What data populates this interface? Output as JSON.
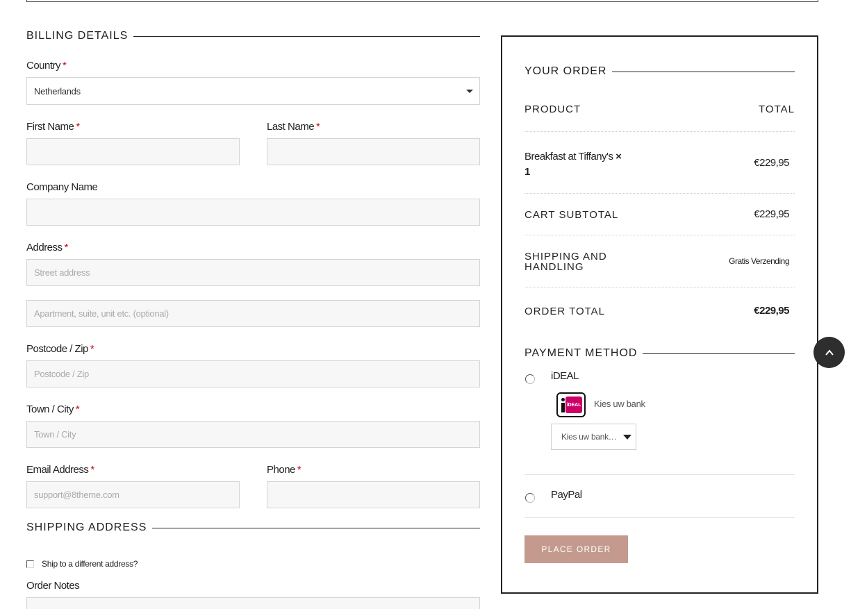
{
  "billing": {
    "title": "BILLING DETAILS",
    "country_label": "Country",
    "country_value": "Netherlands",
    "first_name_label": "First Name",
    "last_name_label": "Last Name",
    "company_label": "Company Name",
    "address_label": "Address",
    "street_placeholder": "Street address",
    "apartment_placeholder": "Apartment, suite, unit etc. (optional)",
    "postcode_label": "Postcode / Zip",
    "postcode_placeholder": "Postcode / Zip",
    "city_label": "Town / City",
    "city_placeholder": "Town / City",
    "email_label": "Email Address",
    "email_placeholder": "support@8theme.com",
    "phone_label": "Phone",
    "required_mark": "*"
  },
  "shipping": {
    "title": "SHIPPING ADDRESS",
    "ship_different_label": "Ship to a different address?",
    "order_notes_label": "Order Notes"
  },
  "order": {
    "title": "YOUR ORDER",
    "product_header": "PRODUCT",
    "total_header": "TOTAL",
    "item_name": "Breakfast at Tiffany's",
    "item_qty": "× 1",
    "item_price": "€229,95",
    "subtotal_label": "CART SUBTOTAL",
    "subtotal_value": "€229,95",
    "shipping_label": "SHIPPING AND HANDLING",
    "shipping_value": "Gratis Verzending",
    "order_total_label": "ORDER TOTAL",
    "order_total_value": "€229,95"
  },
  "payment": {
    "title": "PAYMENT METHOD",
    "ideal_label": "iDEAL",
    "ideal_logo_text": "iDEAL",
    "ideal_description": "Kies uw bank",
    "bank_select_value": "Kies uw bank…",
    "paypal_label": "PayPal",
    "place_order_label": "PLACE ORDER"
  },
  "colors": {
    "accent": "#c59a8e",
    "required": "#d0021b",
    "ideal_pink": "#cc0066"
  },
  "icons": {
    "back_to_top": "chevron-up-icon",
    "select_caret": "caret-down-icon"
  }
}
